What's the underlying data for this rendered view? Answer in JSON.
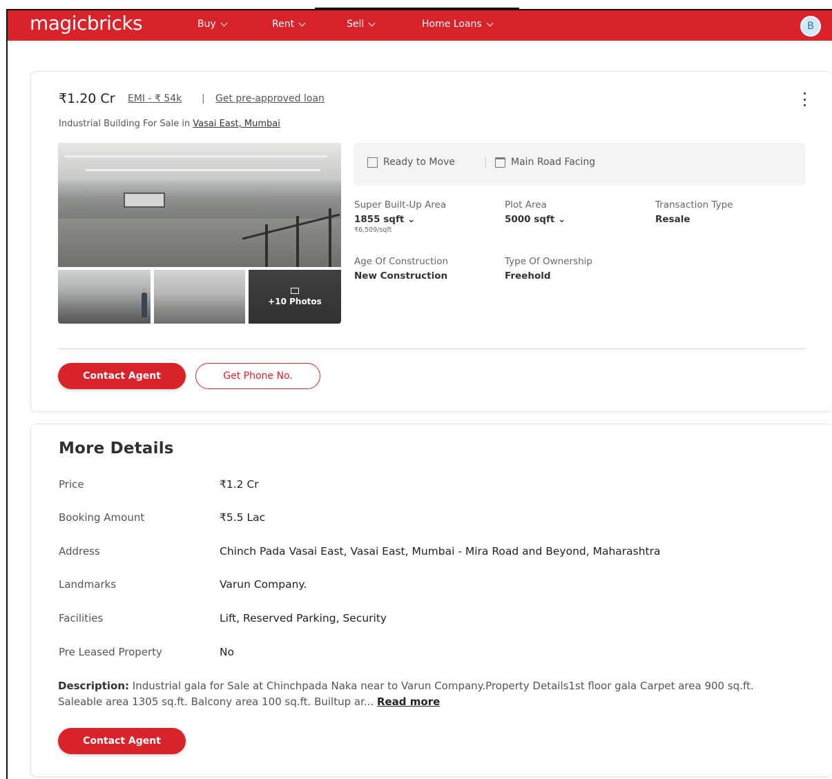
{
  "header": {
    "logo": "magicbricks",
    "nav": [
      {
        "label": "Buy"
      },
      {
        "label": "Rent"
      },
      {
        "label": "Sell"
      },
      {
        "label": "Home Loans"
      }
    ],
    "avatar_initial": "B"
  },
  "listing": {
    "price": "₹1.20 Cr",
    "emi": "EMI - ₹ 54k",
    "separator": "|",
    "preapproved": "Get pre-approved loan",
    "subtitle_prefix": "Industrial Building For Sale in",
    "location": "Vasai East, Mumbai",
    "photos_more": "+10 Photos",
    "tags": [
      "Ready to Move",
      "Main Road Facing"
    ],
    "attributes": [
      {
        "label": "Super Built-Up Area",
        "value": "1855 sqft",
        "sub": "₹6,509/sqft"
      },
      {
        "label": "Plot Area",
        "value": "5000 sqft",
        "sub": ""
      },
      {
        "label": "Transaction Type",
        "value": "Resale",
        "sub": ""
      },
      {
        "label": "Age Of Construction",
        "value": "New Construction",
        "sub": ""
      },
      {
        "label": "Type Of Ownership",
        "value": "Freehold",
        "sub": ""
      }
    ],
    "contact_button": "Contact Agent",
    "phone_button": "Get Phone No."
  },
  "more_details": {
    "title": "More Details",
    "rows": [
      {
        "label": "Price",
        "value": "₹1.2 Cr"
      },
      {
        "label": "Booking Amount",
        "value": "₹5.5 Lac"
      },
      {
        "label": "Address",
        "value": "Chinch Pada Vasai East, Vasai East, Mumbai - Mira Road and Beyond, Maharashtra"
      },
      {
        "label": "Landmarks",
        "value": "Varun Company."
      },
      {
        "label": "Facilities",
        "value": "Lift, Reserved Parking, Security"
      },
      {
        "label": "Pre Leased Property",
        "value": "No"
      }
    ],
    "description_label": "Description:",
    "description_text": "Industrial gala for Sale at Chinchpada Naka near to Varun Company.Property Details1st floor gala Carpet area 900 sq.ft. Saleable area 1305 sq.ft. Balcony area 100 sq.ft. Builtup ar...",
    "read_more": "Read more",
    "contact_button": "Contact Agent"
  },
  "colors": {
    "brand": "#d8232a",
    "text": "#303030",
    "muted": "#666666"
  }
}
